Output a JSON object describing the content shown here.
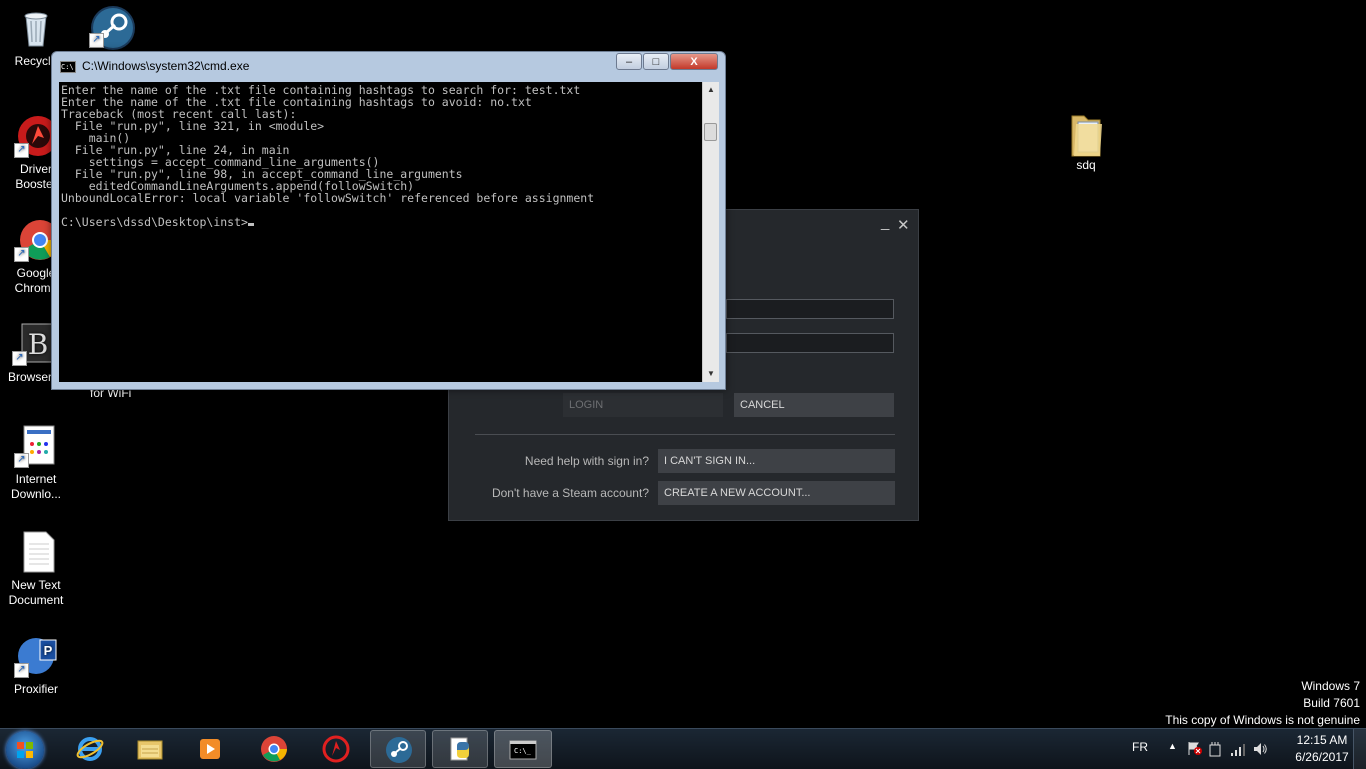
{
  "desktop": {
    "icons_left": [
      {
        "label": "Recycle",
        "icon": "recycle-bin-icon"
      },
      {
        "label": "Driver Booster",
        "icon": "driver-booster-icon"
      },
      {
        "label": "Google Chrome",
        "icon": "chrome-icon"
      },
      {
        "label": "BrowserA",
        "icon": "browser-app-icon"
      },
      {
        "label": "Internet Downlo...",
        "icon": "internet-download-manager-icon"
      },
      {
        "label": "New Text Document",
        "icon": "text-document-icon"
      },
      {
        "label": "Proxifier",
        "icon": "proxifier-icon"
      }
    ],
    "partial_label": "for WiFi",
    "folder_icon": {
      "label": "sdq",
      "icon": "folder-icon"
    },
    "steam_desktop_icon": "steam-icon"
  },
  "cmd_window": {
    "title": "C:\\Windows\\system32\\cmd.exe",
    "buttons": {
      "minimize": "–",
      "maximize": "□",
      "close": "X"
    },
    "lines": [
      "Enter the name of the .txt file containing hashtags to search for: test.txt",
      "Enter the name of the .txt file containing hashtags to avoid: no.txt",
      "Traceback (most recent call last):",
      "  File \"run.py\", line 321, in <module>",
      "    main()",
      "  File \"run.py\", line 24, in main",
      "    settings = accept_command_line_arguments()",
      "  File \"run.py\", line 98, in accept_command_line_arguments",
      "    editedCommandLineArguments.append(followSwitch)",
      "UnboundLocalError: local variable 'followSwitch' referenced before assignment",
      "",
      "C:\\Users\\dssd\\Desktop\\inst>"
    ]
  },
  "steam_login": {
    "minimize": "_",
    "close": "✕",
    "login_button": "LOGIN",
    "cancel_button": "CANCEL",
    "help_label": "Need help with sign in?",
    "help_button": "I CAN'T SIGN IN...",
    "create_label": "Don't have a Steam account?",
    "create_button": "CREATE A NEW ACCOUNT..."
  },
  "watermark": {
    "line1": "Windows 7",
    "line2": "Build 7601",
    "line3": "This copy of Windows is not genuine"
  },
  "taskbar": {
    "pinned": [
      "ie-icon",
      "explorer-icon",
      "media-player-icon",
      "chrome-icon",
      "driver-booster-icon",
      "steam-icon",
      "python-icon",
      "cmd-icon"
    ],
    "language": "FR",
    "time": "12:15 AM",
    "date": "6/26/2017"
  },
  "colors": {
    "desktop_bg": "#000000",
    "steam_bg": "#25282c",
    "cmd_frame": "#b6c9e0",
    "taskbar": "#121a23"
  }
}
